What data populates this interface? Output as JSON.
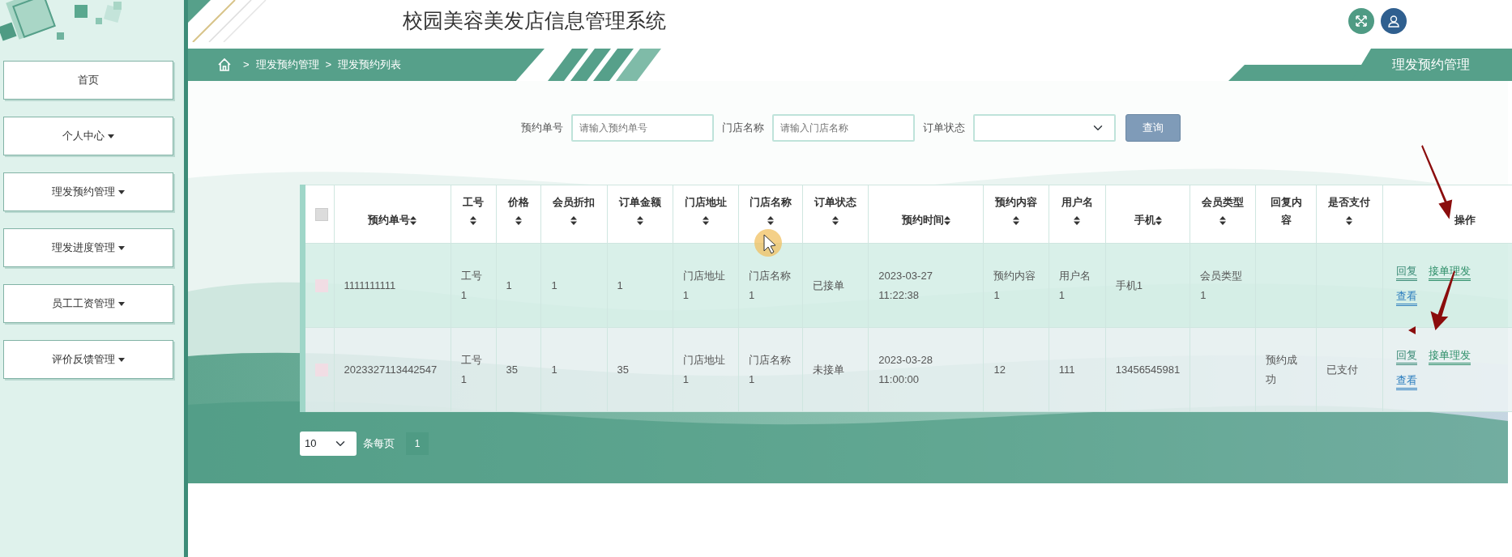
{
  "header": {
    "title": "校园美容美发店信息管理系统",
    "breadcrumb": [
      {
        "separator": ">",
        "label": "理发预约管理"
      },
      {
        "separator": ">",
        "label": "理发预约列表"
      }
    ],
    "banner": "理发预约管理"
  },
  "sidebar": {
    "items": [
      {
        "label": "首页",
        "dropdown": false
      },
      {
        "label": "个人中心",
        "dropdown": true
      },
      {
        "label": "理发预约管理",
        "dropdown": true
      },
      {
        "label": "理发进度管理",
        "dropdown": true
      },
      {
        "label": "员工工资管理",
        "dropdown": true
      },
      {
        "label": "评价反馈管理",
        "dropdown": true
      }
    ]
  },
  "search": {
    "fields": [
      {
        "kind": "input",
        "label": "预约单号",
        "placeholder": "请输入预约单号"
      },
      {
        "kind": "input",
        "label": "门店名称",
        "placeholder": "请输入门店名称"
      },
      {
        "kind": "select",
        "label": "订单状态"
      }
    ],
    "button": "查询"
  },
  "table": {
    "header_checked": false,
    "columns": [
      {
        "label": "预约单号",
        "kind": "inline"
      },
      {
        "label": "工号",
        "kind": "below"
      },
      {
        "label": "价格",
        "kind": "below"
      },
      {
        "label": "会员折扣",
        "kind": "below"
      },
      {
        "label": "订单金额",
        "kind": "below"
      },
      {
        "label": "门店地址",
        "kind": "below"
      },
      {
        "label": "门店名称",
        "kind": "below"
      },
      {
        "label": "订单状态",
        "kind": "below"
      },
      {
        "label": "预约时间",
        "kind": "inline"
      },
      {
        "label": "预约内容",
        "kind": "below"
      },
      {
        "label": "用户名",
        "kind": "below"
      },
      {
        "label": "手机",
        "kind": "inline"
      },
      {
        "label": "会员类型",
        "kind": "below"
      },
      {
        "label": "回复内容",
        "kind": "plain"
      },
      {
        "label": "是否支付",
        "kind": "below"
      },
      {
        "label": "操作",
        "kind": "plain"
      }
    ],
    "rows": [
      {
        "selected": false,
        "cells": [
          "1111111111",
          "工号1",
          "1",
          "1",
          "1",
          "门店地址1",
          "门店名称1",
          "已接单",
          "2023-03-27 11:22:38",
          "预约内容1",
          "用户名1",
          "手机1",
          "会员类型1",
          "",
          ""
        ],
        "actions": [
          {
            "kind": "reply",
            "label": "回复"
          },
          {
            "kind": "accept",
            "label": "接单理发"
          },
          {
            "kind": "view",
            "label": "查看"
          }
        ]
      },
      {
        "selected": false,
        "cells": [
          "2023327113442547",
          "工号1",
          "35",
          "1",
          "35",
          "门店地址1",
          "门店名称1",
          "未接单",
          "2023-03-28 11:00:00",
          "12",
          "111",
          "13456545981",
          "",
          "预约成功",
          "已支付"
        ],
        "actions": [
          {
            "kind": "reply",
            "label": "回复"
          },
          {
            "kind": "accept",
            "label": "接单理发"
          },
          {
            "kind": "view",
            "label": "查看"
          }
        ]
      }
    ]
  },
  "pagination": {
    "page_size": "10",
    "page_size_label": "条每页",
    "pages": [
      {
        "label": "1",
        "selected": true
      }
    ]
  }
}
